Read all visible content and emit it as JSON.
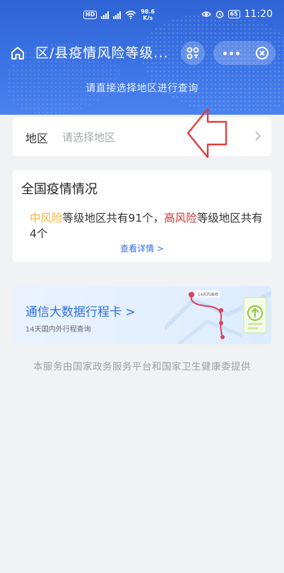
{
  "status_bar": {
    "hd": "HD",
    "net_speed_value": "98.6",
    "net_speed_unit": "K/s",
    "battery": "65",
    "time": "11:20"
  },
  "nav": {
    "title": "区/县疫情风险等级..."
  },
  "header": {
    "subtitle": "请直接选择地区进行查询"
  },
  "region_select": {
    "label": "地区",
    "placeholder": "请选择地区"
  },
  "national": {
    "title": "全国疫情情况",
    "mid_risk_label": "中风险",
    "mid_risk_text": "等级地区共有91个，",
    "high_risk_label": "高风险",
    "high_risk_text": "等级地区共有4个",
    "detail_link": "查看详情 >"
  },
  "travel_card": {
    "title": "通信大数据行程卡 >",
    "subtitle": "14天国内外行程查询",
    "map_tag": "14天内途经"
  },
  "footer": {
    "note": "本服务由国家政务服务平台和国家卫生健康委提供"
  },
  "colors": {
    "header_blue": "#3b73e4",
    "link_blue": "#2f6fe4",
    "mid_risk": "#f0b43a",
    "high_risk": "#c8322f",
    "annotation_red": "#e03c3c"
  }
}
